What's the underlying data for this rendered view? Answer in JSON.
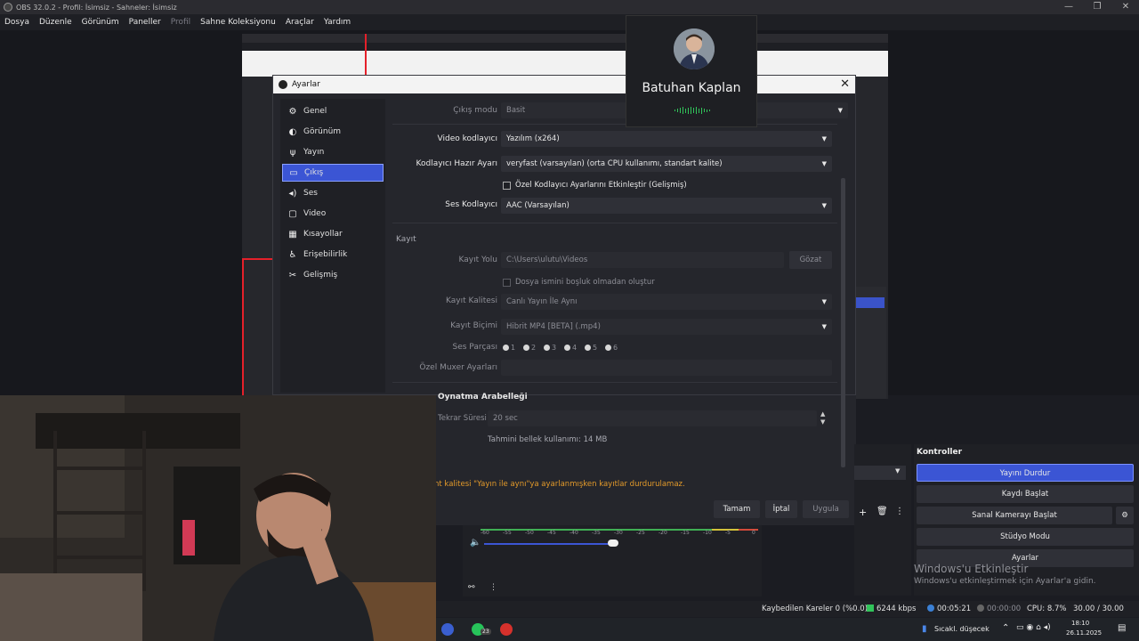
{
  "window": {
    "title": "OBS 32.0.2 - Profil: İsimsiz - Sahneler: İsimsiz",
    "controls": [
      "—",
      "❐",
      "✕"
    ]
  },
  "menu": [
    {
      "label": "Dosya"
    },
    {
      "label": "Düzenle"
    },
    {
      "label": "Görünüm"
    },
    {
      "label": "Paneller"
    },
    {
      "label": "Profil"
    },
    {
      "label": "Sahne Koleksiyonu"
    },
    {
      "label": "Araçlar"
    },
    {
      "label": "Yardım"
    }
  ],
  "participant": {
    "name": "Batuhan Kaplan"
  },
  "settings_dialog": {
    "title": "Ayarlar",
    "close": "✕",
    "sidebar": [
      {
        "label": "Genel",
        "icon": "⚙"
      },
      {
        "label": "Görünüm",
        "icon": "◐"
      },
      {
        "label": "Yayın",
        "icon": "ψ"
      },
      {
        "label": "Çıkış",
        "icon": "▭",
        "active": true
      },
      {
        "label": "Ses",
        "icon": "◂)"
      },
      {
        "label": "Video",
        "icon": "▢"
      },
      {
        "label": "Kısayollar",
        "icon": "▦"
      },
      {
        "label": "Erişebilirlik",
        "icon": "♿"
      },
      {
        "label": "Gelişmiş",
        "icon": "✂"
      }
    ],
    "output_mode_label": "Çıkış modu",
    "output_mode_value": "Basit",
    "video_encoder_label": "Video kodlayıcı",
    "video_encoder_value": "Yazılım (x264)",
    "encoder_preset_label": "Kodlayıcı Hazır Ayarı",
    "encoder_preset_value": "veryfast (varsayılan) (orta CPU kullanımı, standart kalite)",
    "custom_encoder_check": "Özel Kodlayıcı Ayarlarını Etkinleştir (Gelişmiş)",
    "audio_encoder_label": "Ses Kodlayıcı",
    "audio_encoder_value": "AAC (Varsayılan)",
    "recording_section": "Kayıt",
    "record_path_label": "Kayıt Yolu",
    "record_path_value": "C:\\Users\\ulutu\\Videos",
    "browse_button": "Gözat",
    "no_space_check": "Dosya ismini boşluk olmadan oluştur",
    "quality_label": "Kayıt Kalitesi",
    "quality_value": "Canlı Yayın İle Aynı",
    "format_label": "Kayıt Biçimi",
    "format_value": "Hibrit MP4 [BETA] (.mp4)",
    "audio_track_label": "Ses Parçası",
    "audio_tracks": [
      "1",
      "2",
      "3",
      "4",
      "5",
      "6"
    ],
    "muxer_label": "Özel Muxer Ayarları",
    "replay_section": "Oynatma Arabelleği",
    "replay_time_label": "Tekrar Süresi",
    "replay_time_value": "20 sec",
    "memory_note": "Tahmini bellek kullanımı: 14 MB",
    "warning": "nt kalitesi \"Yayın ile aynı\"ya ayarlanmışken kayıtlar durdurulamaz.",
    "ok_button": "Tamam",
    "cancel_button": "İptal",
    "apply_button": "Uygula"
  },
  "controls_panel": {
    "header": "Kontroller",
    "buttons": [
      {
        "label": "Yayını Durdur",
        "primary": true
      },
      {
        "label": "Kaydı Başlat"
      },
      {
        "label": "Sanal Kamerayı Başlat"
      },
      {
        "label": "Stüdyo Modu"
      },
      {
        "label": "Ayarlar"
      }
    ]
  },
  "mixer": {
    "ticks": [
      "-60",
      "-55",
      "-50",
      "-45",
      "-40",
      "-35",
      "-30",
      "-25",
      "-20",
      "-15",
      "-10",
      "-5",
      "0"
    ]
  },
  "activation": {
    "title": "Windows'u Etkinleştir",
    "body": "Windows'u etkinleştirmek için Ayarlar'a gidin."
  },
  "statusbar": {
    "dropped": "Kaybedilen Kareler 0 (%0.0)",
    "bitrate": "6244 kbps",
    "stream_time": "00:05:21",
    "record_time": "00:00:00",
    "cpu": "CPU: 8.7%",
    "fps": "30.00 / 30.00 FPS"
  },
  "taskbar": {
    "weather": "Sıcakl. düşecek",
    "badge": "23",
    "time": "18:10",
    "date": "26.11.2025"
  },
  "colors": {
    "accent": "#3b55d4",
    "warning": "#e39a2a",
    "live_green": "#31c45a"
  }
}
